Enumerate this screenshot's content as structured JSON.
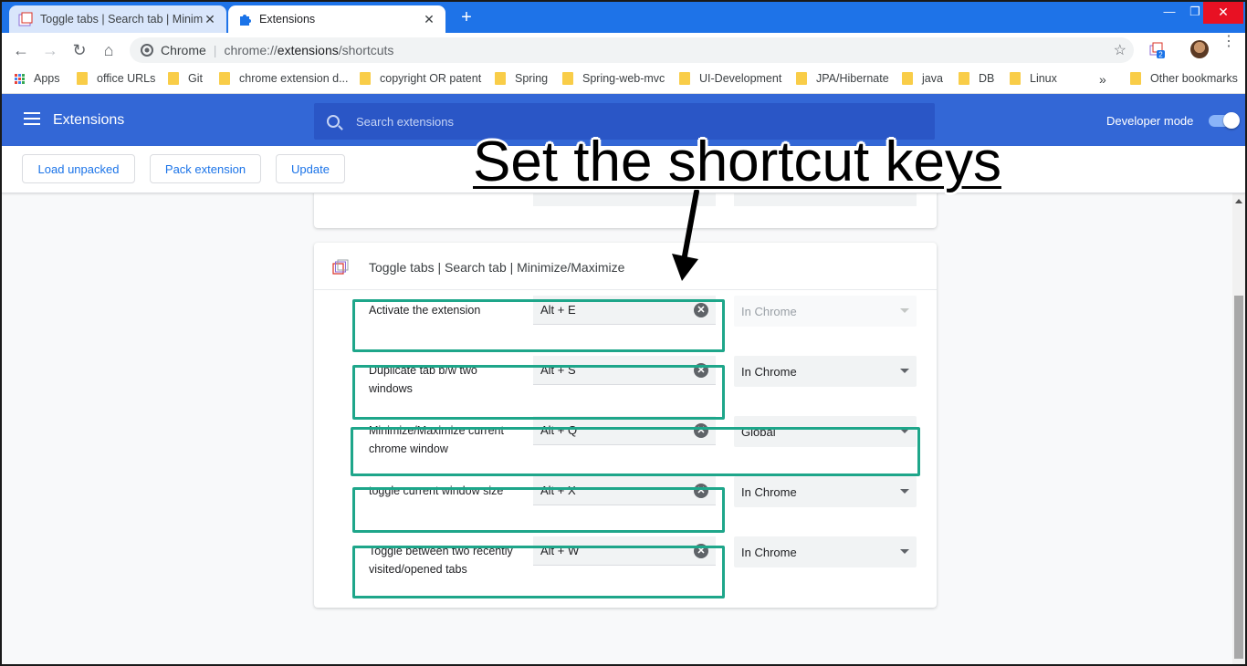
{
  "browser": {
    "tabs": [
      {
        "title": "Toggle tabs | Search tab | Minimize/Maximize"
      },
      {
        "title": "Extensions"
      }
    ],
    "omnibox": {
      "site": "Chrome",
      "url_host": "chrome://",
      "url_path_bold": "extensions",
      "url_rest": "/shortcuts"
    },
    "extension_badge": "2",
    "bookmarks": [
      "Apps",
      "office URLs",
      "Git",
      "chrome extension d...",
      "copyright OR patent",
      "Spring",
      "Spring-web-mvc",
      "UI-Development",
      "JPA/Hibernate",
      "java",
      "DB",
      "Linux"
    ],
    "bookmarks_more": "»",
    "other_bookmarks": "Other bookmarks"
  },
  "header": {
    "title": "Extensions",
    "search_placeholder": "Search extensions",
    "developer_mode_label": "Developer mode",
    "developer_mode": true
  },
  "actions": {
    "load_unpacked": "Load unpacked",
    "pack_extension": "Pack extension",
    "update": "Update"
  },
  "extension": {
    "name": "Toggle tabs | Search tab | Minimize/Maximize",
    "commands": [
      {
        "description": "Activate the extension",
        "shortcut": "Alt + E",
        "scope": "In Chrome",
        "scope_enabled": false
      },
      {
        "description": "Duplicate tab b/w two windows",
        "shortcut": "Alt + S",
        "scope": "In Chrome",
        "scope_enabled": true
      },
      {
        "description": "Minimize/Maximize current chrome window",
        "shortcut": "Alt + Q",
        "scope": "Global",
        "scope_enabled": true
      },
      {
        "description": "toggle current window size",
        "shortcut": "Alt + X",
        "scope": "In Chrome",
        "scope_enabled": true
      },
      {
        "description": "Toggle between two recently visited/opened tabs",
        "shortcut": "Alt + W",
        "scope": "In Chrome",
        "scope_enabled": true
      }
    ]
  },
  "annotation": {
    "text": "Set the shortcut keys",
    "highlight_color": "#1ea68a"
  },
  "colors": {
    "tabstrip": "#1e73e8",
    "header": "#3367d6",
    "accent": "#1a73e8"
  }
}
